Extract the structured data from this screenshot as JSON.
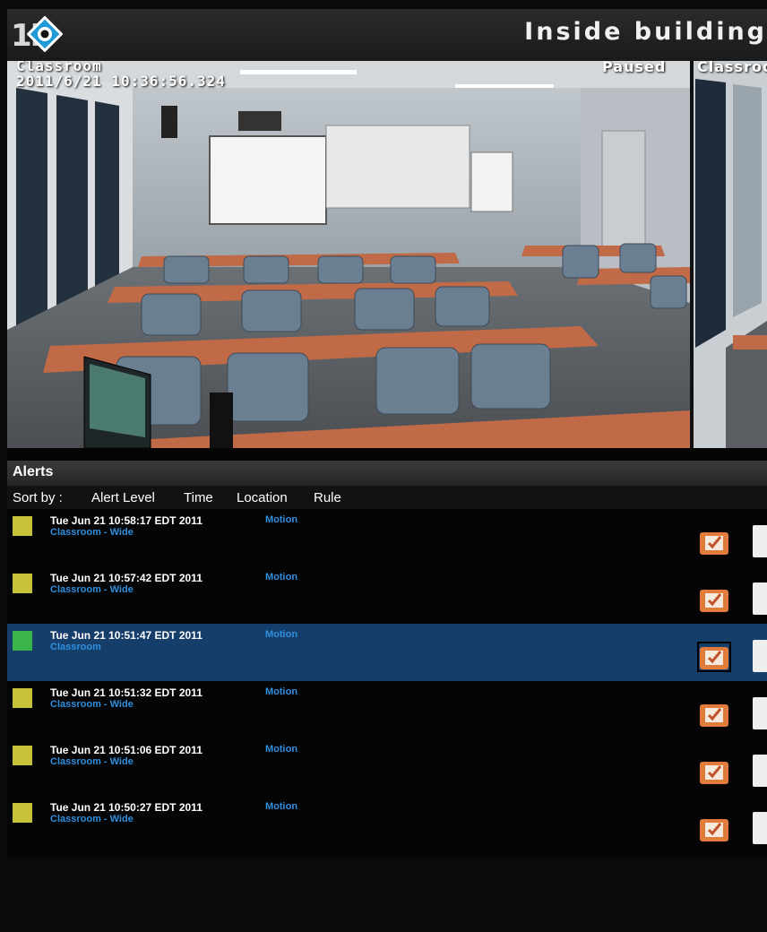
{
  "header": {
    "logo_text": "1E",
    "title": "Inside building"
  },
  "video": {
    "camera_name": "Classroom",
    "timestamp": "2011/6/21  10:36:56.324",
    "status": "Paused",
    "second_camera_name": "Classroom"
  },
  "alerts": {
    "title": "Alerts",
    "sort_label": "Sort by :",
    "sort_options": [
      "Alert Level",
      "Time",
      "Location",
      "Rule"
    ],
    "items": [
      {
        "time": "Tue Jun 21 10:58:17 EDT 2011",
        "location": "Classroom - Wide",
        "rule": "Motion",
        "level_color": "#c8c23a"
      },
      {
        "time": "Tue Jun 21 10:57:42 EDT 2011",
        "location": "Classroom - Wide",
        "rule": "Motion",
        "level_color": "#c8c23a"
      },
      {
        "time": "Tue Jun 21 10:51:47 EDT 2011",
        "location": "Classroom",
        "rule": "Motion",
        "level_color": "#3ab54a"
      },
      {
        "time": "Tue Jun 21 10:51:32 EDT 2011",
        "location": "Classroom - Wide",
        "rule": "Motion",
        "level_color": "#c8c23a"
      },
      {
        "time": "Tue Jun 21 10:51:06 EDT 2011",
        "location": "Classroom - Wide",
        "rule": "Motion",
        "level_color": "#c8c23a"
      },
      {
        "time": "Tue Jun 21 10:50:27 EDT 2011",
        "location": "Classroom - Wide",
        "rule": "Motion",
        "level_color": "#c8c23a"
      }
    ]
  },
  "colors": {
    "selected_row": "#163e6b",
    "link_blue": "#2f8fe0",
    "ack_orange": "#e07b3a"
  }
}
